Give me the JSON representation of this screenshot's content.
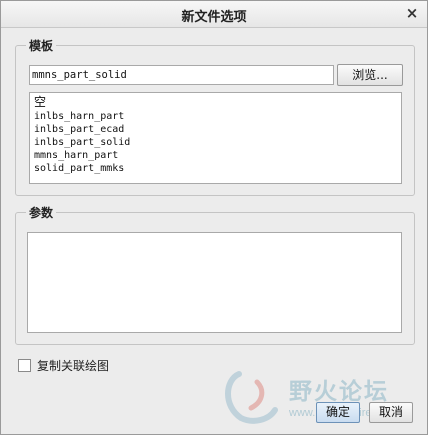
{
  "dialog": {
    "title": "新文件选项",
    "close_label": "×"
  },
  "templates": {
    "legend": "模板",
    "selected_value": "mmns_part_solid",
    "browse_label": "浏览...",
    "items": [
      "空",
      "inlbs_harn_part",
      "inlbs_part_ecad",
      "inlbs_part_solid",
      "mmns_harn_part",
      "solid_part_mmks"
    ]
  },
  "parameters": {
    "legend": "参数"
  },
  "copy_drawing": {
    "label": "复制关联绘图",
    "checked": false
  },
  "footer": {
    "ok_label": "确定",
    "cancel_label": "取消"
  },
  "watermark": {
    "brand": "野火论坛",
    "url": "www.proewildfire.cn"
  }
}
